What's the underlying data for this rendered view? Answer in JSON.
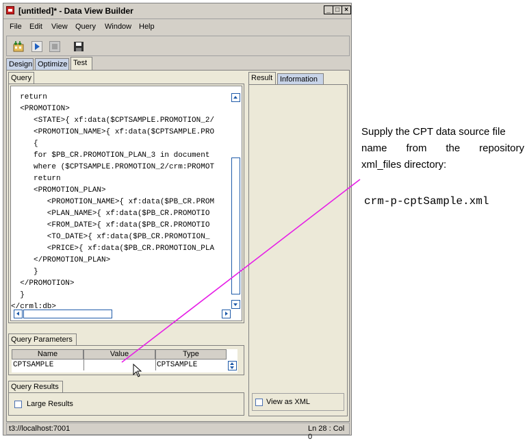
{
  "window": {
    "title": "[untitled]* - Data View Builder",
    "controls": [
      "_",
      "□",
      "×"
    ]
  },
  "menu": [
    "File",
    "Edit",
    "View",
    "Query",
    "Window",
    "Help"
  ],
  "mode_tabs": [
    "Design",
    "Optimize",
    "Test"
  ],
  "query_tab": "Query",
  "code_lines": [
    "  return",
    "  <PROMOTION>",
    "     <STATE>{ xf:data($CPTSAMPLE.PROMOTION_2/",
    "     <PROMOTION_NAME>{ xf:data($CPTSAMPLE.PRO",
    "     {",
    "     for $PB_CR.PROMOTION_PLAN_3 in document",
    "     where ($CPTSAMPLE.PROMOTION_2/crm:PROMOT",
    "     return",
    "     <PROMOTION_PLAN>",
    "        <PROMOTION_NAME>{ xf:data($PB_CR.PROM",
    "        <PLAN_NAME>{ xf:data($PB_CR.PROMOTIO",
    "        <FROM_DATE>{ xf:data($PB_CR.PROMOTIO",
    "        <TO_DATE>{ xf:data($PB_CR.PROMOTION_",
    "        <PRICE>{ xf:data($PB_CR.PROMOTION_PLA",
    "     </PROMOTION_PLAN>",
    "     }",
    "  </PROMOTION>",
    "  }",
    "</crml:db>"
  ],
  "query_parameters": {
    "tab": "Query Parameters",
    "columns": [
      "Name",
      "Value",
      "Type"
    ],
    "rows": [
      [
        "CPTSAMPLE",
        "",
        "CPTSAMPLE"
      ]
    ]
  },
  "query_results": {
    "tab": "Query Results",
    "large_results": "Large Results"
  },
  "result_tabs": [
    "Result",
    "Information"
  ],
  "view_as_xml": "View as XML",
  "status": {
    "server": "t3://localhost:7001",
    "position": "Ln 28 : Col 0"
  },
  "callout": {
    "lines": [
      "Supply the CPT data source file",
      "name from the repository",
      "xml_files directory:"
    ],
    "filename": "crm-p-cptSample.xml"
  },
  "colors": {
    "callout_line": "#e61ee6",
    "window_bg": "#d4d0c8",
    "scroll_accent": "#1e5aa8"
  },
  "icons": [
    "load-data-icon",
    "run-icon",
    "stop-icon",
    "save-icon"
  ]
}
